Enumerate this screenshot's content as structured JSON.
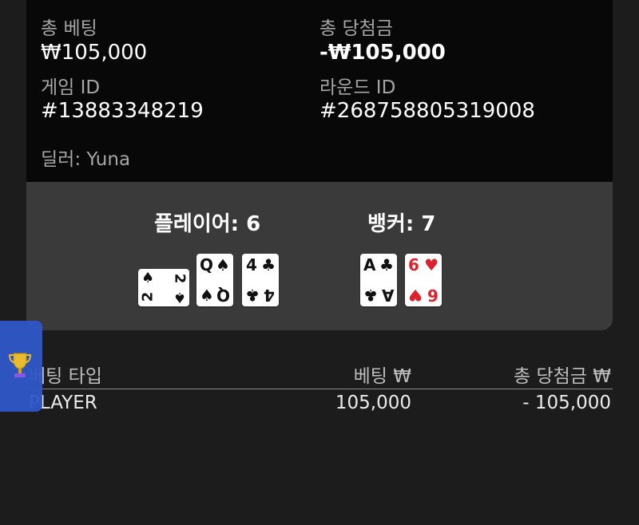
{
  "summary": {
    "total_bet_label": "총 베팅",
    "total_bet_value": "₩105,000",
    "total_win_label": "총 당첨금",
    "total_win_value": "-₩105,000",
    "game_id_label": "게임 ID",
    "game_id_value": "#13883348219",
    "round_id_label": "라운드 ID",
    "round_id_value": "#268758805319008",
    "dealer_text": "딜러: Yuna"
  },
  "hands": {
    "player_title": "플레이어: 6",
    "banker_title": "뱅커: 7",
    "player_cards": [
      {
        "rank": "2",
        "suit": "♠",
        "color": "#111111",
        "orientation": "rotated"
      },
      {
        "rank": "Q",
        "suit": "♠",
        "color": "#111111",
        "orientation": "upright"
      },
      {
        "rank": "4",
        "suit": "♣",
        "color": "#111111",
        "orientation": "upright"
      }
    ],
    "banker_cards": [
      {
        "rank": "A",
        "suit": "♣",
        "color": "#111111",
        "orientation": "upright"
      },
      {
        "rank": "6",
        "suit": "♥",
        "color": "#e0202a",
        "orientation": "upright"
      }
    ]
  },
  "trophy": {
    "icon": "trophy-icon"
  },
  "table": {
    "headers": [
      "베팅 타입",
      "베팅 ₩",
      "총 당첨금 ₩"
    ],
    "rows": [
      [
        "PLAYER",
        "105,000",
        "- 105,000"
      ]
    ]
  }
}
